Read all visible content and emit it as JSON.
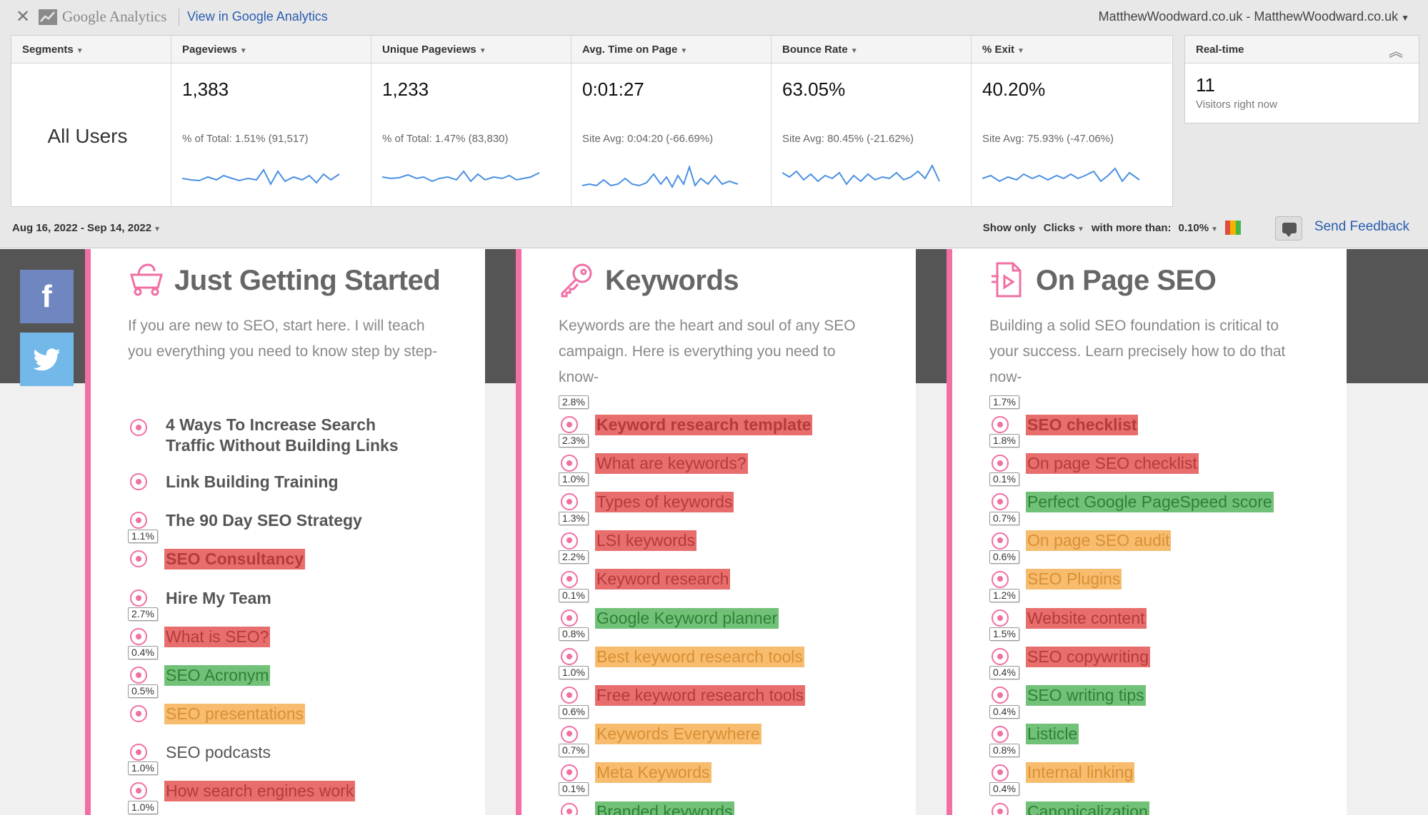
{
  "ga": {
    "brand": "Google Analytics",
    "view_link": "View in Google Analytics",
    "account": "MatthewWoodward.co.uk - MatthewWoodward.co.uk",
    "segments_label": "Segments",
    "segment_value": "All Users",
    "metrics": [
      {
        "label": "Pageviews",
        "value": "1,383",
        "sub": "% of Total: 1.51% (91,517)"
      },
      {
        "label": "Unique Pageviews",
        "value": "1,233",
        "sub": "% of Total: 1.47% (83,830)"
      },
      {
        "label": "Avg. Time on Page",
        "value": "0:01:27",
        "sub": "Site Avg: 0:04:20 (-66.69%)"
      },
      {
        "label": "Bounce Rate",
        "value": "63.05%",
        "sub": "Site Avg: 80.45% (-21.62%)"
      },
      {
        "label": "% Exit",
        "value": "40.20%",
        "sub": "Site Avg: 75.93% (-47.06%)"
      }
    ],
    "realtime": {
      "label": "Real-time",
      "count": "11",
      "sublabel": "Visitors right now"
    },
    "date_range": "Aug 16, 2022 - Sep 14, 2022",
    "filter": {
      "show_only": "Show only",
      "metric": "Clicks",
      "with_more": "with more than:",
      "threshold": "0.10%"
    },
    "feedback": "Send Feedback",
    "colors": {
      "link": "#2a5db0",
      "spark": "#4a90e2"
    }
  },
  "site": {
    "colors": {
      "accent": "#f06fa5",
      "red": "#e86e6e",
      "green": "#72c178",
      "orange": "#f7bc6e"
    },
    "social": {
      "facebook_icon": "facebook-icon",
      "twitter_icon": "twitter-icon"
    },
    "columns": [
      {
        "title": "Just Getting Started",
        "icon": "basket-icon",
        "description": "If you are new to SEO, start here.  I will teach you everything you need to know step by step-",
        "items": [
          {
            "text": "4 Ways To Increase Search Traffic Without Building Links",
            "pct": "",
            "color": "none"
          },
          {
            "text": "Link Building Training",
            "pct": "",
            "color": "none"
          },
          {
            "text": "The 90 Day SEO Strategy",
            "pct": "",
            "color": "none"
          },
          {
            "text": "SEO Consultancy",
            "pct": "1.1%",
            "color": "red"
          },
          {
            "text": "Hire My Team",
            "pct": "",
            "color": "none"
          },
          {
            "text": "What is SEO?",
            "pct": "2.7%",
            "color": "red"
          },
          {
            "text": "SEO Acronym",
            "pct": "0.4%",
            "color": "green"
          },
          {
            "text": "SEO presentations",
            "pct": "0.5%",
            "color": "orange"
          },
          {
            "text": "SEO podcasts",
            "pct": "",
            "color": "none"
          },
          {
            "text": "How search engines work",
            "pct": "1.0%",
            "color": "red"
          },
          {
            "text": "",
            "pct": "1.0%",
            "color": "none"
          }
        ]
      },
      {
        "title": "Keywords",
        "icon": "key-icon",
        "description": "Keywords are the heart and soul of any SEO campaign.  Here is everything you need to know-",
        "items": [
          {
            "text": "Keyword research template",
            "pct": "2.8%",
            "color": "red"
          },
          {
            "text": "What are keywords?",
            "pct": "2.3%",
            "color": "red"
          },
          {
            "text": "Types of keywords",
            "pct": "1.0%",
            "color": "red"
          },
          {
            "text": "LSI keywords",
            "pct": "1.3%",
            "color": "red"
          },
          {
            "text": "Keyword research",
            "pct": "2.2%",
            "color": "red"
          },
          {
            "text": "Google Keyword planner",
            "pct": "0.1%",
            "color": "green"
          },
          {
            "text": "Best keyword research tools",
            "pct": "0.8%",
            "color": "orange"
          },
          {
            "text": "Free keyword research tools",
            "pct": "1.0%",
            "color": "red"
          },
          {
            "text": "Keywords Everywhere",
            "pct": "0.6%",
            "color": "orange"
          },
          {
            "text": "Meta Keywords",
            "pct": "0.7%",
            "color": "orange"
          },
          {
            "text": "Branded keywords",
            "pct": "0.1%",
            "color": "green"
          }
        ]
      },
      {
        "title": "On Page SEO",
        "icon": "document-icon",
        "description": "Building a solid SEO foundation is critical to your success.  Learn precisely how to do that now-",
        "items": [
          {
            "text": "SEO checklist",
            "pct": "1.7%",
            "color": "red"
          },
          {
            "text": "On page SEO checklist",
            "pct": "1.8%",
            "color": "red"
          },
          {
            "text": "Perfect Google PageSpeed score",
            "pct": "0.1%",
            "color": "green"
          },
          {
            "text": "On page SEO audit",
            "pct": "0.7%",
            "color": "orange"
          },
          {
            "text": "SEO Plugins",
            "pct": "0.6%",
            "color": "orange"
          },
          {
            "text": "Website content",
            "pct": "1.2%",
            "color": "red"
          },
          {
            "text": "SEO copywriting",
            "pct": "1.5%",
            "color": "red"
          },
          {
            "text": "SEO writing tips",
            "pct": "0.4%",
            "color": "green"
          },
          {
            "text": "Listicle",
            "pct": "0.4%",
            "color": "green"
          },
          {
            "text": "Internal linking",
            "pct": "0.8%",
            "color": "orange"
          },
          {
            "text": "Canonicalization",
            "pct": "0.4%",
            "color": "green"
          }
        ]
      }
    ]
  }
}
